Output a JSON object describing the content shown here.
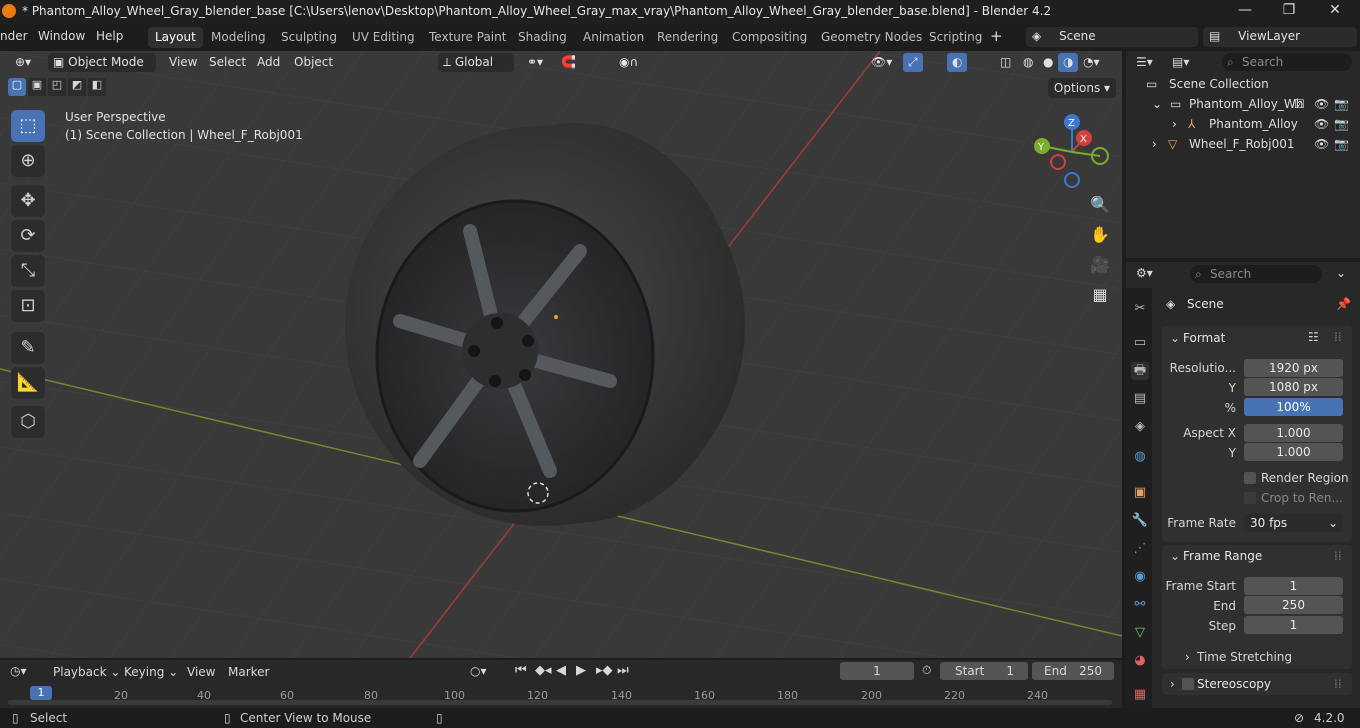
{
  "window": {
    "title": "* Phantom_Alloy_Wheel_Gray_blender_base [C:\\Users\\lenov\\Desktop\\Phantom_Alloy_Wheel_Gray_max_vray\\Phantom_Alloy_Wheel_Gray_blender_base.blend] - Blender 4.2",
    "minimize": "—",
    "maximize": "❐",
    "close": "✕"
  },
  "menu": {
    "render": "nder",
    "window": "Window",
    "help": "Help"
  },
  "workspaces": [
    "Layout",
    "Modeling",
    "Sculpting",
    "UV Editing",
    "Texture Paint",
    "Shading",
    "Animation",
    "Rendering",
    "Compositing",
    "Geometry Nodes",
    "Scripting"
  ],
  "scene": {
    "label": "Scene",
    "viewlayer": "ViewLayer"
  },
  "viewport": {
    "mode": "Object Mode",
    "view": "View",
    "select": "Select",
    "add": "Add",
    "object": "Object",
    "orientation": "Global",
    "options": "Options",
    "perspective": "User Perspective",
    "collection_info": "(1) Scene Collection | Wheel_F_Robj001",
    "gizmo": {
      "x": "X",
      "y": "Y",
      "z": "Z"
    }
  },
  "outliner": {
    "search_placeholder": "Search",
    "root": "Scene Collection",
    "items": [
      {
        "label": "Phantom_Alloy_Wh"
      },
      {
        "label": "Phantom_Alloy"
      },
      {
        "label": "Wheel_F_Robj001"
      }
    ]
  },
  "properties": {
    "search_placeholder": "Search",
    "context": "Scene",
    "format": {
      "title": "Format",
      "res_label": "Resolutio...",
      "res_x": "1920 px",
      "y_label": "Y",
      "res_y": "1080 px",
      "pct_label": "%",
      "pct": "100%",
      "aspx_label": "Aspect X",
      "aspx": "1.000",
      "aspy_label": "Y",
      "aspy": "1.000",
      "render_region": "Render Region",
      "crop": "Crop to Ren...",
      "framerate_label": "Frame Rate",
      "framerate": "30 fps"
    },
    "frame_range": {
      "title": "Frame Range",
      "start_label": "Frame Start",
      "start": "1",
      "end_label": "End",
      "end": "250",
      "step_label": "Step",
      "step": "1"
    },
    "time_stretching": "Time Stretching",
    "stereoscopy": "Stereoscopy"
  },
  "timeline": {
    "playback": "Playback",
    "keying": "Keying",
    "view": "View",
    "marker": "Marker",
    "current": "1",
    "start_label": "Start",
    "start": "1",
    "end_label": "End",
    "end": "250",
    "ticks": [
      "1",
      "20",
      "40",
      "60",
      "80",
      "100",
      "120",
      "140",
      "160",
      "180",
      "200",
      "220",
      "240"
    ]
  },
  "status": {
    "select": "Select",
    "center": "Center View to Mouse",
    "version": "4.2.0"
  }
}
